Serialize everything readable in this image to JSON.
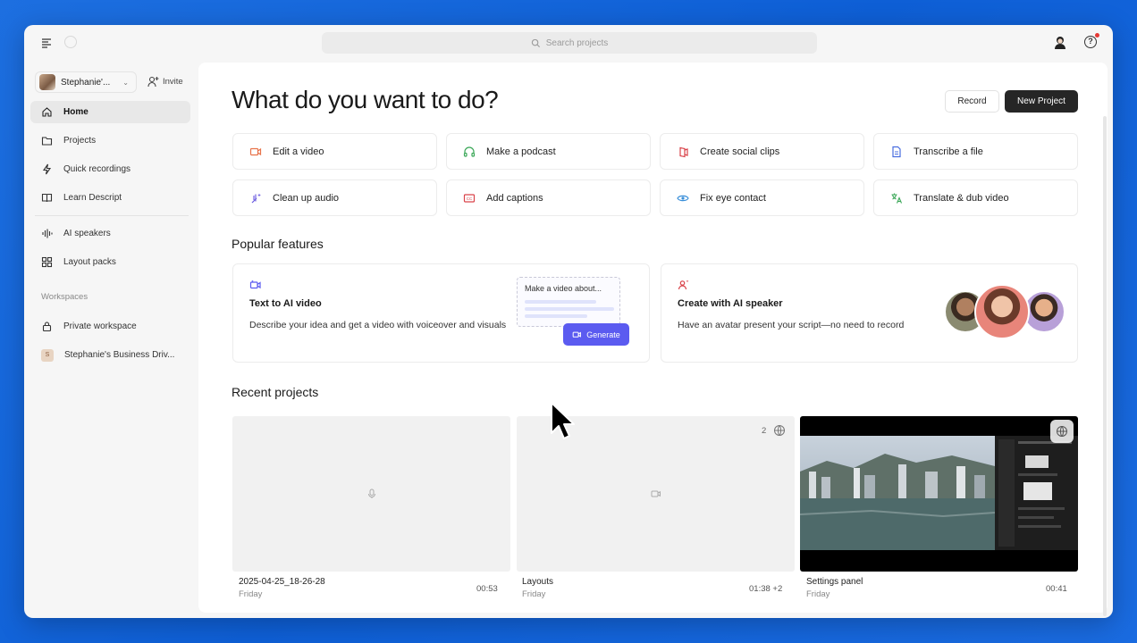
{
  "search": {
    "placeholder": "Search projects"
  },
  "sidebar": {
    "workspace_name": "Stephanie'...",
    "invite_label": "Invite",
    "items": [
      {
        "label": "Home",
        "icon": "home-icon"
      },
      {
        "label": "Projects",
        "icon": "folder-icon"
      },
      {
        "label": "Quick recordings",
        "icon": "bolt-icon"
      },
      {
        "label": "Learn Descript",
        "icon": "book-icon"
      },
      {
        "label": "AI speakers",
        "icon": "waveform-icon"
      },
      {
        "label": "Layout packs",
        "icon": "grid-icon"
      }
    ],
    "workspaces_label": "Workspaces",
    "workspaces": [
      {
        "label": "Private workspace",
        "icon": "lock-icon"
      },
      {
        "label": "Stephanie's Business Driv...",
        "avatar_letter": "S"
      }
    ]
  },
  "main": {
    "title": "What do you want to do?",
    "record_label": "Record",
    "new_project_label": "New Project",
    "actions": [
      {
        "label": "Edit a video",
        "icon": "video-camera-icon",
        "color": "#e8734a"
      },
      {
        "label": "Make a podcast",
        "icon": "headphones-icon",
        "color": "#3aa757"
      },
      {
        "label": "Create social clips",
        "icon": "social-clip-icon",
        "color": "#d9434a"
      },
      {
        "label": "Transcribe a file",
        "icon": "document-icon",
        "color": "#4a6ee0"
      },
      {
        "label": "Clean up audio",
        "icon": "sparkle-wand-icon",
        "color": "#6a5ae0"
      },
      {
        "label": "Add captions",
        "icon": "captions-icon",
        "color": "#d9434a"
      },
      {
        "label": "Fix eye contact",
        "icon": "eye-icon",
        "color": "#3a8fd9"
      },
      {
        "label": "Translate & dub video",
        "icon": "translate-icon",
        "color": "#3aa757"
      }
    ],
    "popular_title": "Popular features",
    "features": [
      {
        "title": "Text to AI video",
        "desc": "Describe your idea and get a video with voiceover and visuals",
        "prompt_text": "Make a video about...",
        "generate_label": "Generate"
      },
      {
        "title": "Create with AI speaker",
        "desc": "Have an avatar present your script—no need to record"
      }
    ],
    "recent_title": "Recent projects",
    "projects": [
      {
        "name": "2025-04-25_18-26-28",
        "day": "Friday",
        "duration": "00:53",
        "icon": "microphone-icon"
      },
      {
        "name": "Layouts",
        "day": "Friday",
        "duration": "01:38 +2",
        "icon": "video-icon",
        "lang_count": "2"
      },
      {
        "name": "Settings panel",
        "day": "Friday",
        "duration": "00:41",
        "icon": "video-thumbnail"
      }
    ]
  }
}
